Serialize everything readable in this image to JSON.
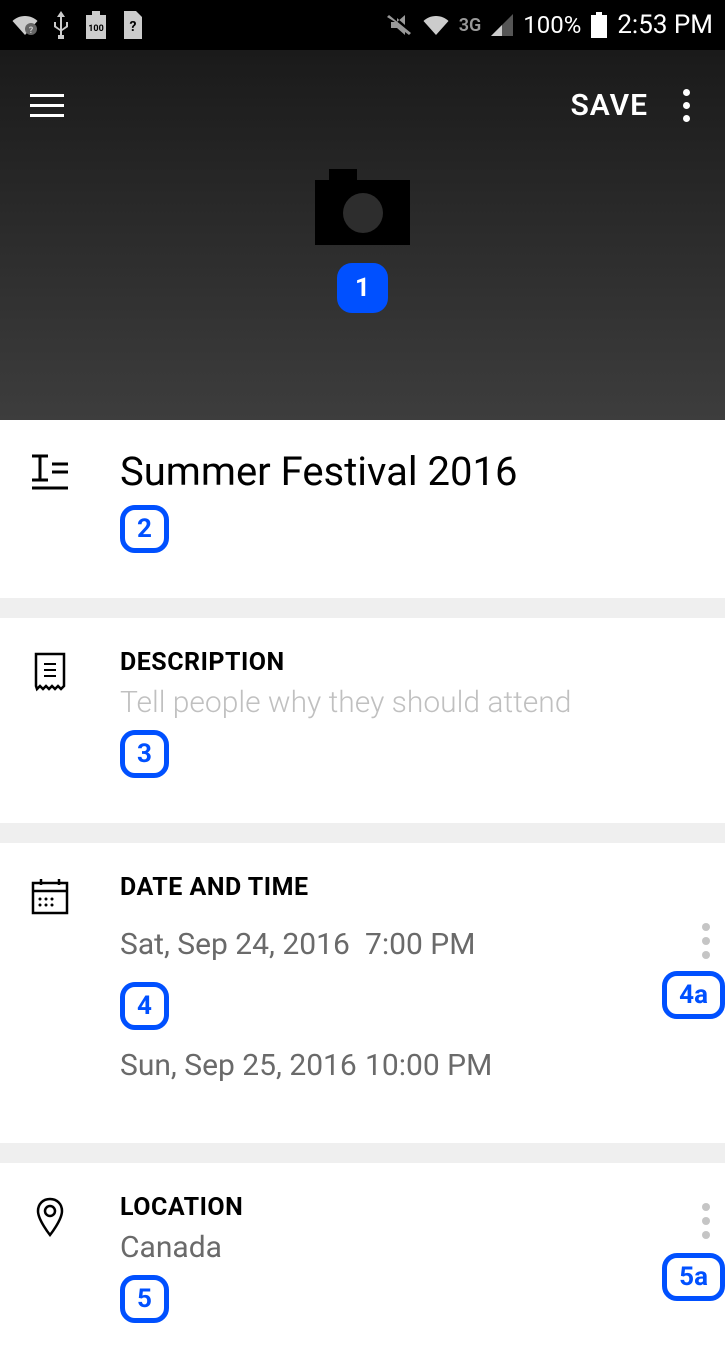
{
  "status_bar": {
    "network": "3G",
    "battery": "100%",
    "time": "2:53 PM"
  },
  "app_bar": {
    "save_label": "SAVE"
  },
  "hints": {
    "camera": "1",
    "title": "2",
    "description": "3",
    "date": "4",
    "date_more": "4a",
    "location": "5",
    "location_more": "5a"
  },
  "title": {
    "value": "Summer Festival 2016"
  },
  "description": {
    "label": "DESCRIPTION",
    "placeholder": "Tell people why they should attend"
  },
  "datetime": {
    "label": "DATE AND TIME",
    "start_date": "Sat, Sep 24, 2016",
    "start_time": "7:00 PM",
    "end_date": "Sun, Sep 25, 2016",
    "end_time": "10:00 PM"
  },
  "location": {
    "label": "LOCATION",
    "value": "Canada"
  }
}
